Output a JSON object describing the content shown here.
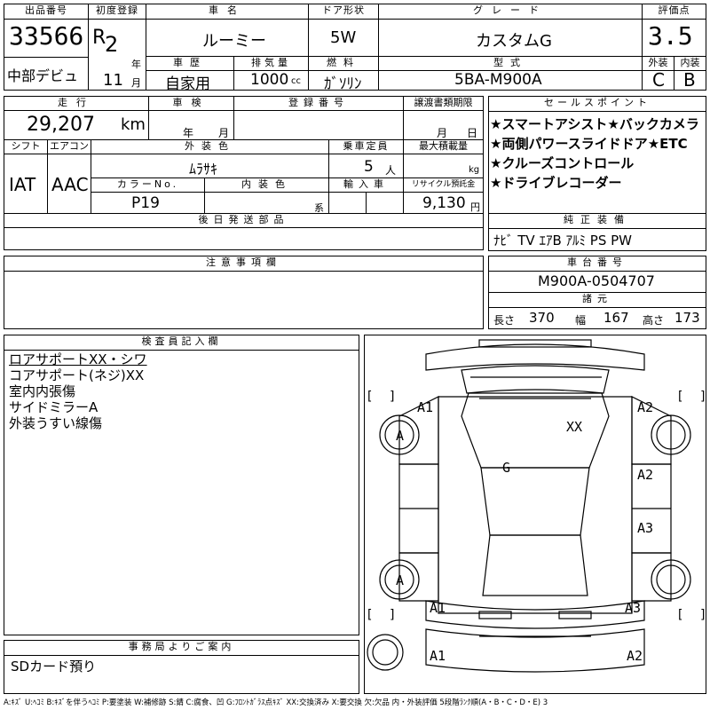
{
  "header": {
    "lot_label": "出品番号",
    "lot_no": "33566",
    "debut": "中部デビュ",
    "first_reg_label": "初度登録",
    "era": "R",
    "year": "2",
    "year_unit": "年",
    "month": "11",
    "month_unit": "月",
    "car_name_label": "車名",
    "car_name": "ルーミー",
    "history_label": "車歴",
    "history": "自家用",
    "displacement_label": "排気量",
    "displacement": "1000",
    "displacement_unit": "cc",
    "door_label": "ドア形状",
    "door": "5W",
    "fuel_label": "燃料",
    "fuel": "ｶﾞｿﾘﾝ",
    "grade_label": "グレード",
    "grade": "カスタムG",
    "model_label": "型式",
    "model": "5BA-M900A",
    "score_label": "評価点",
    "score": "3.5",
    "ext_label": "外装",
    "ext": "C",
    "int_label": "内装",
    "int": "B"
  },
  "row2": {
    "mileage_label": "走行",
    "mileage": "29,207",
    "mileage_unit": "km",
    "inspection_label": "車検",
    "insp_year_unit": "年",
    "insp_month_unit": "月",
    "reg_no_label": "登録番号",
    "transfer_label": "譲渡書類期限",
    "transfer_month_unit": "月",
    "transfer_day_unit": "日",
    "shift_label": "シフト",
    "shift": "IAT",
    "ac_label": "エアコン",
    "ac": "AAC",
    "color_label": "外装色",
    "color": "ﾑﾗｻｷ",
    "capacity_label": "乗車定員",
    "capacity": "5",
    "capacity_unit": "人",
    "load_label": "最大積載量",
    "load_unit": "kg",
    "color_no_label": "カラーNo.",
    "color_no": "P19",
    "int_color_label": "内装色",
    "int_color_unit": "系",
    "import_label": "輸入車",
    "recycle_label": "リサイクル預託金",
    "recycle": "9,130",
    "recycle_unit": "円",
    "later_parts_label": "後日発送部品"
  },
  "sales": {
    "label": "セールスポイント",
    "lines": [
      "★スマートアシスト★バックカメラ",
      "★両側パワースライドドア★ETC",
      "★クルーズコントロール",
      "★ドライブレコーダー"
    ]
  },
  "equipment": {
    "label": "純正装備",
    "value": "ﾅﾋﾞ TV ｴｱB ｱﾙﾐ PS PW"
  },
  "notes": {
    "label": "注意事項欄"
  },
  "chassis": {
    "label": "車台番号",
    "value": "M900A-0504707",
    "spec_label": "諸元",
    "length_label": "長さ",
    "length": "370",
    "width_label": "幅",
    "width": "167",
    "height_label": "高さ",
    "height": "173"
  },
  "inspector": {
    "label": "検査員記入欄",
    "lines": [
      "ロアサポートXX・シワ",
      "コアサポート(ネジ)XX",
      "室内内張傷",
      "サイドミラーA",
      "外装うすい線傷"
    ]
  },
  "office": {
    "label": "事務局よりご案内",
    "value": "SDカード預り"
  },
  "diagram_marks": {
    "front_left_top": "A1",
    "front_right_top": "A2",
    "left_front_wheel": "A",
    "roof": "XX",
    "windshield": "G",
    "right_door_front": "A2",
    "right_door_rear": "A3",
    "left_rear_wheel": "A",
    "rear_left": "A1",
    "rear_right": "A3",
    "bumper_left": "A1",
    "bumper_right": "A2"
  },
  "footer": "A:ｷｽﾞ U:ﾍｺﾐ B:ｷｽﾞを伴うﾍｺﾐ P:要塗装 W:補修跡 S:錆 C:腐食、凹 G:ﾌﾛﾝﾄｶﾞﾗｽ点ｷｽﾞ XX:交換済み X:要交換 欠:欠品 内・外装評価 5段階ﾗﾝｸ順(A・B・C・D・E) 3"
}
